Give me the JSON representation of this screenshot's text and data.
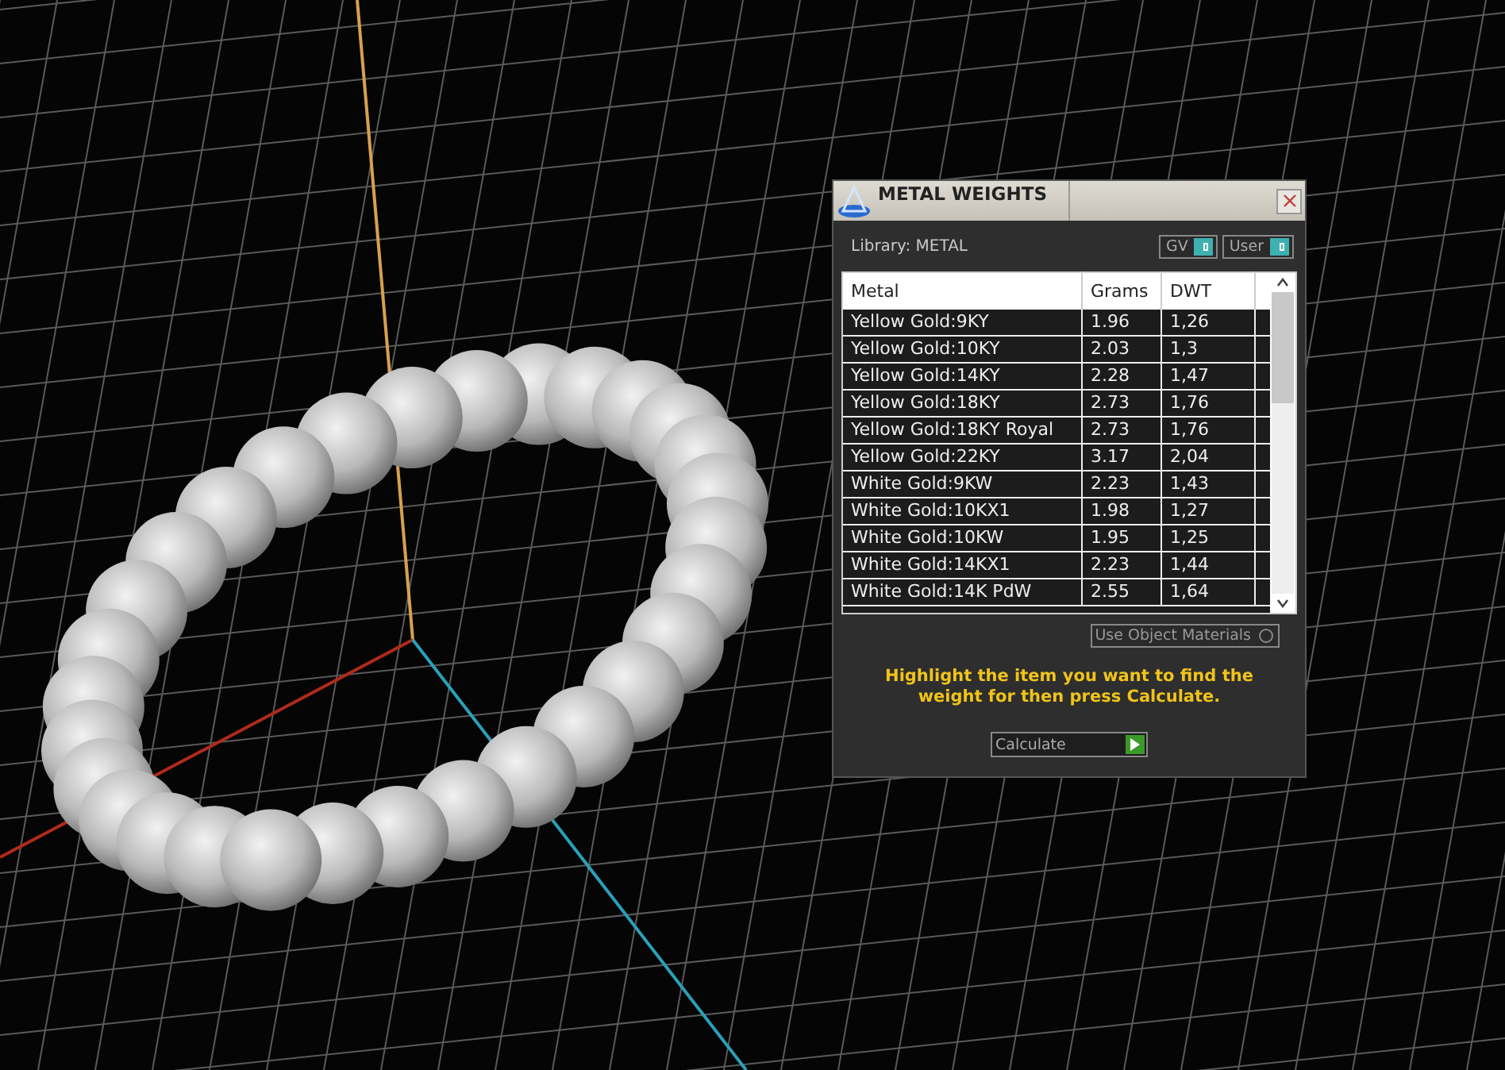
{
  "window": {
    "title": "METAL WEIGHTS"
  },
  "library_label": "Library: METAL",
  "toggles": [
    {
      "label": "GV",
      "on": true
    },
    {
      "label": "User",
      "on": true
    }
  ],
  "table": {
    "columns": [
      "Metal",
      "Grams",
      "DWT"
    ],
    "rows": [
      [
        "Yellow Gold:9KY",
        "1.96",
        "1,26"
      ],
      [
        "Yellow Gold:10KY",
        "2.03",
        "1,3"
      ],
      [
        "Yellow Gold:14KY",
        "2.28",
        "1,47"
      ],
      [
        "Yellow Gold:18KY",
        "2.73",
        "1,76"
      ],
      [
        "Yellow Gold:18KY Royal",
        "2.73",
        "1,76"
      ],
      [
        "Yellow Gold:22KY",
        "3.17",
        "2,04"
      ],
      [
        "White Gold:9KW",
        "2.23",
        "1,43"
      ],
      [
        "White Gold:10KX1",
        "1.98",
        "1,27"
      ],
      [
        "White Gold:10KW",
        "1.95",
        "1,25"
      ],
      [
        "White Gold:14KX1",
        "2.23",
        "1,44"
      ],
      [
        "White Gold:14K PdW",
        "2.55",
        "1,64"
      ]
    ]
  },
  "use_object_materials": {
    "label": "Use Object Materials",
    "checked": false
  },
  "hint": "Highlight the item you want to find the weight for then press Calculate.",
  "calculate_button": "Calculate"
}
